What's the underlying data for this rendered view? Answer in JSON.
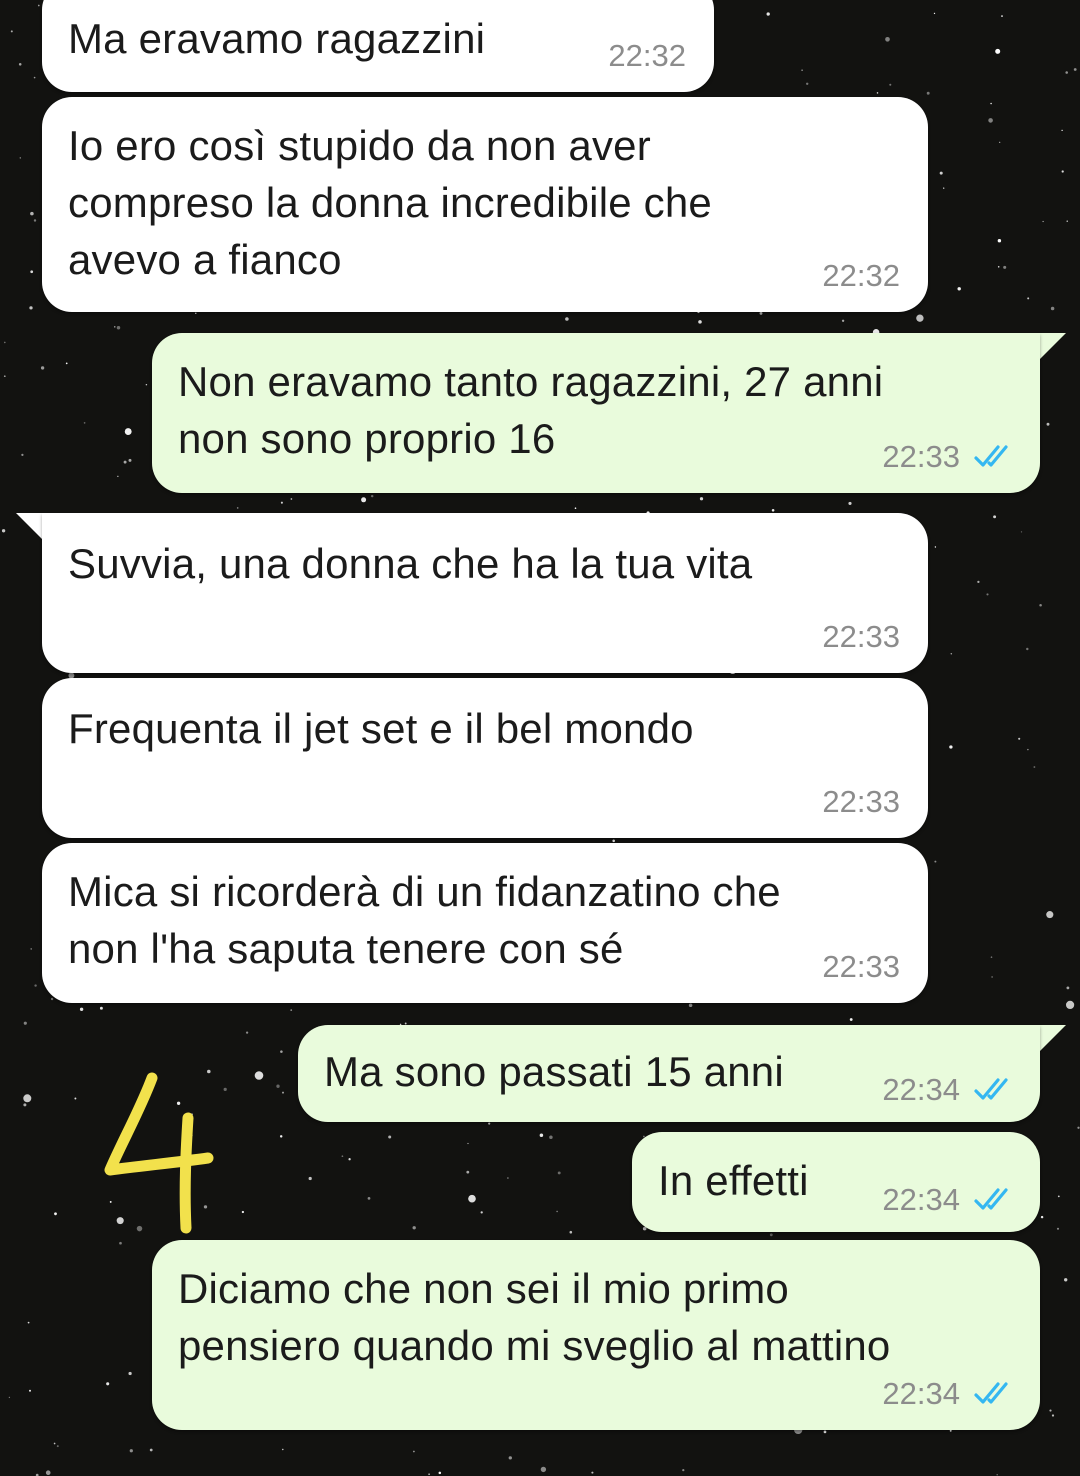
{
  "chat": {
    "messages": [
      {
        "direction": "incoming",
        "text": "Ma eravamo ragazzini",
        "time": "22:32"
      },
      {
        "direction": "incoming",
        "text": "Io ero così stupido da non aver\ncompreso la donna incredibile che\navevo a fianco",
        "time": "22:32"
      },
      {
        "direction": "outgoing",
        "text": "Non eravamo tanto ragazzini, 27 anni\nnon sono proprio 16",
        "time": "22:33",
        "status": "read"
      },
      {
        "direction": "incoming",
        "text": "Suvvia, una donna che ha la tua vita",
        "time": "22:33"
      },
      {
        "direction": "incoming",
        "text": "Frequenta il jet set e il bel mondo",
        "time": "22:33"
      },
      {
        "direction": "incoming",
        "text": "Mica si ricorderà di un fidanzatino che\nnon l'ha saputa tenere con sé",
        "time": "22:33"
      },
      {
        "direction": "outgoing",
        "text": "Ma sono passati 15 anni",
        "time": "22:34",
        "status": "read"
      },
      {
        "direction": "outgoing",
        "text": "In effetti",
        "time": "22:34",
        "status": "read"
      },
      {
        "direction": "outgoing",
        "text": "Diciamo che non sei il mio primo\npensiero quando mi sveglio al mattino",
        "time": "22:34",
        "status": "read"
      }
    ]
  },
  "overlay": {
    "handwritten_number": "4",
    "color": "#f2e14c"
  },
  "colors": {
    "incoming_bubble": "#ffffff",
    "outgoing_bubble": "#e9fbdc",
    "read_ticks": "#34b7f1",
    "timestamp": "#8c8c8c",
    "background": "#0b0b0b"
  },
  "icons": {
    "read_status": "double-check-icon"
  }
}
